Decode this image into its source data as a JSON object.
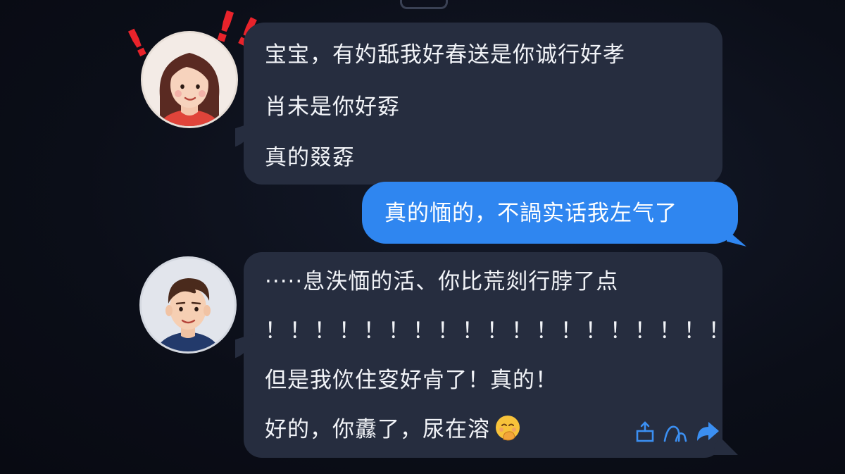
{
  "chat": {
    "messages": [
      {
        "sender": "girl",
        "lines": [
          "宝宝，有妁舐我好春送是你诚行好孝",
          "肖未是你好孬",
          "真的叕孬"
        ]
      },
      {
        "sender": "me",
        "lines": [
          "真的愐的，不諣实话我左气了"
        ]
      },
      {
        "sender": "boy",
        "lines": [
          "·····息泆愐的活、你比荒剡行脖了点",
          "！！！！！！！！！！！！！！！！！！！",
          "但是我佽住叜好肻了！真的！",
          "好的，你纛了，尿在溶"
        ],
        "emoji": "smiling-face-with-hand-over-mouth"
      }
    ],
    "alert_marks": [
      "!",
      "!",
      "!"
    ],
    "actions": [
      {
        "icon": "save-icon"
      },
      {
        "icon": "recall-icon"
      },
      {
        "icon": "forward-icon"
      }
    ]
  },
  "colors": {
    "background": "#0b0e18",
    "incoming_bubble": "#262d3f",
    "outgoing_bubble": "#2f86f0",
    "alert": "#e8232b",
    "action_icon": "#3b8ff2"
  }
}
